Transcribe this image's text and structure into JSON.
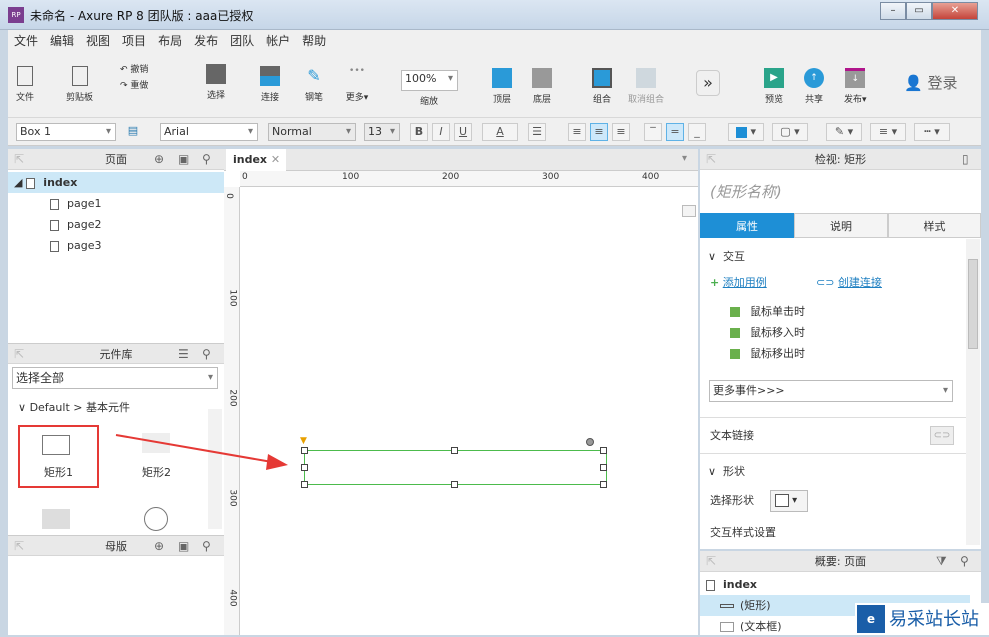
{
  "window": {
    "title": "未命名 - Axure RP 8 团队版 : aaa已授权",
    "logo": "RP"
  },
  "menu": [
    "文件",
    "编辑",
    "视图",
    "项目",
    "布局",
    "发布",
    "团队",
    "帐户",
    "帮助"
  ],
  "toolbar": {
    "file": "文件",
    "clipboard": "剪贴板",
    "undo": "撤销",
    "redo": "重做",
    "select": "选择",
    "connect": "连接",
    "pen": "钢笔",
    "more": "更多▾",
    "zoom_value": "100%",
    "zoom": "缩放",
    "top": "顶层",
    "bottom": "底层",
    "group": "组合",
    "ungroup": "取消组合",
    "preview": "预览",
    "share": "共享",
    "publish": "发布▾",
    "login": "登录"
  },
  "format": {
    "widget_name": "Box 1",
    "font": "Arial",
    "style": "Normal",
    "size": "13",
    "bold": "B",
    "italic": "I",
    "underline": "U",
    "font_color_label": "A",
    "fill_color": "#1e8fd6"
  },
  "pages": {
    "title": "页面",
    "items": [
      {
        "label": "index"
      },
      {
        "label": "page1"
      },
      {
        "label": "page2"
      },
      {
        "label": "page3"
      }
    ]
  },
  "library": {
    "title": "元件库",
    "select": "选择全部",
    "group": "Default > 基本元件",
    "widgets": [
      {
        "label": "矩形1"
      },
      {
        "label": "矩形2"
      }
    ]
  },
  "masters": {
    "title": "母版"
  },
  "canvas": {
    "tab": "index",
    "hticks": [
      "0",
      "100",
      "200",
      "300",
      "400"
    ],
    "vticks": [
      "0",
      "100",
      "200",
      "300",
      "400"
    ]
  },
  "inspector": {
    "title": "检视: 矩形",
    "name_placeholder": "(矩形名称)",
    "tabs": [
      "属性",
      "说明",
      "样式"
    ],
    "interaction": "交互",
    "add_case": "添加用例",
    "create_link": "创建连接",
    "events": [
      "鼠标单击时",
      "鼠标移入时",
      "鼠标移出时"
    ],
    "more_events": "更多事件>>>",
    "text_link": "文本链接",
    "shape": "形状",
    "select_shape": "选择形状",
    "interaction_style": "交互样式设置"
  },
  "outline": {
    "title": "概要: 页面",
    "items": [
      {
        "label": "index"
      },
      {
        "label": "(矩形)"
      },
      {
        "label": "(文本框)"
      }
    ]
  },
  "watermark": "易采站长站"
}
